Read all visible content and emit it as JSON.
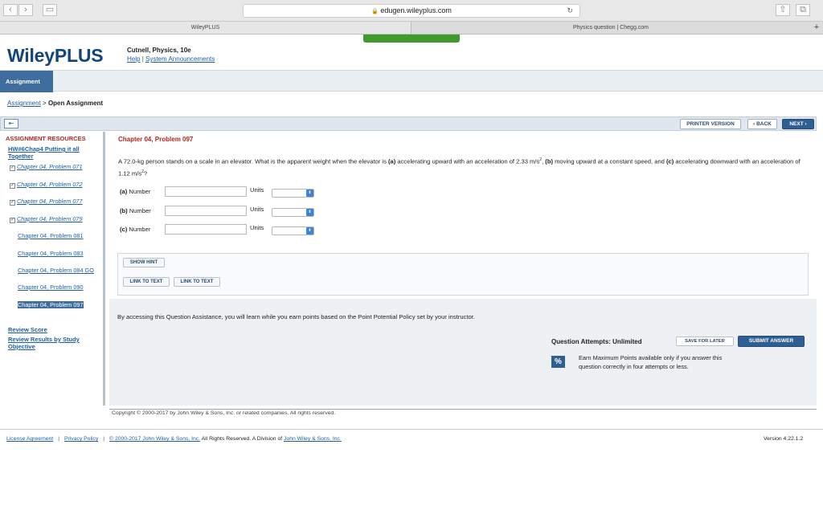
{
  "browser": {
    "url": "edugen.wileyplus.com",
    "tabs": [
      "WileyPLUS",
      "Physics question | Chegg.com"
    ]
  },
  "header": {
    "logo": "WileyPLUS",
    "course": "Cutnell, Physics, 10e",
    "help": "Help",
    "announcements": "System Announcements"
  },
  "nav": {
    "assignment_tab": "Assignment",
    "breadcrumb_link": "Assignment",
    "breadcrumb_sep": ">",
    "breadcrumb_current": "Open Assignment"
  },
  "toolbar": {
    "printer": "PRINTER VERSION",
    "back": "‹ BACK",
    "next": "NEXT ›"
  },
  "sidebar": {
    "title": "ASSIGNMENT RESOURCES",
    "hw": "HW#6Chap4 Putting it all Together",
    "items": [
      {
        "label": "Chapter 04, Problem 071",
        "checked": true
      },
      {
        "label": "Chapter 04, Problem 072",
        "checked": true
      },
      {
        "label": "Chapter 04, Problem 077",
        "checked": true
      },
      {
        "label": "Chapter 04, Problem 079",
        "checked": true
      },
      {
        "label": "Chapter 04, Problem 081",
        "checked": false
      },
      {
        "label": "Chapter 04, Problem 083",
        "checked": false
      },
      {
        "label": "Chapter 04, Problem 084 GO",
        "checked": false
      },
      {
        "label": "Chapter 04, Problem 090",
        "checked": false
      },
      {
        "label": "Chapter 04, Problem 097",
        "checked": false,
        "active": true
      }
    ],
    "review_score": "Review Score",
    "review_results": "Review Results by Study Objective"
  },
  "problem": {
    "title": "Chapter 04, Problem 097",
    "text_1": "A 72.0-kg person stands on a scale in an elevator. What is the apparent weight when the elevator is ",
    "text_a": "(a)",
    "text_2": " accelerating upward with an acceleration of 2.33 m/s",
    "text_3": ", ",
    "text_b": "(b)",
    "text_4": " moving upward at a constant speed, and ",
    "text_c": "(c)",
    "text_5": " accelerating downward with an acceleration of 1.12 m/s",
    "text_6": "?",
    "sup": "2",
    "rows": [
      {
        "label_bold": "(a)",
        "label": " Number",
        "units": "Units",
        "value": ""
      },
      {
        "label_bold": "(b)",
        "label": " Number",
        "units": "Units",
        "value": ""
      },
      {
        "label_bold": "(c)",
        "label": " Number",
        "units": "Units",
        "value": ""
      }
    ]
  },
  "hints": {
    "show_hint": "SHOW HINT",
    "link1": "LINK TO TEXT",
    "link2": "LINK TO TEXT"
  },
  "assist": {
    "text": "By accessing this Question Assistance, you will learn while you earn points based on the Point Potential Policy set by your instructor.",
    "attempts": "Question Attempts: Unlimited",
    "save": "SAVE FOR LATER",
    "submit": "SUBMIT ANSWER",
    "pct": "%",
    "earn": "Earn Maximum Points available only if you answer this question correctly in four attempts or less."
  },
  "footer": {
    "copyright": "Copyright © 2000-2017 by John Wiley & Sons, Inc. or related companies. All rights reserved.",
    "license": "License Agreement",
    "privacy": "Privacy Policy",
    "copy_link": "© 2000-2017 John Wiley & Sons, Inc.",
    "rights": " All Rights Reserved. A Division of ",
    "company": "John Wiley & Sons, Inc.",
    "version": "Version 4.22.1.2"
  }
}
